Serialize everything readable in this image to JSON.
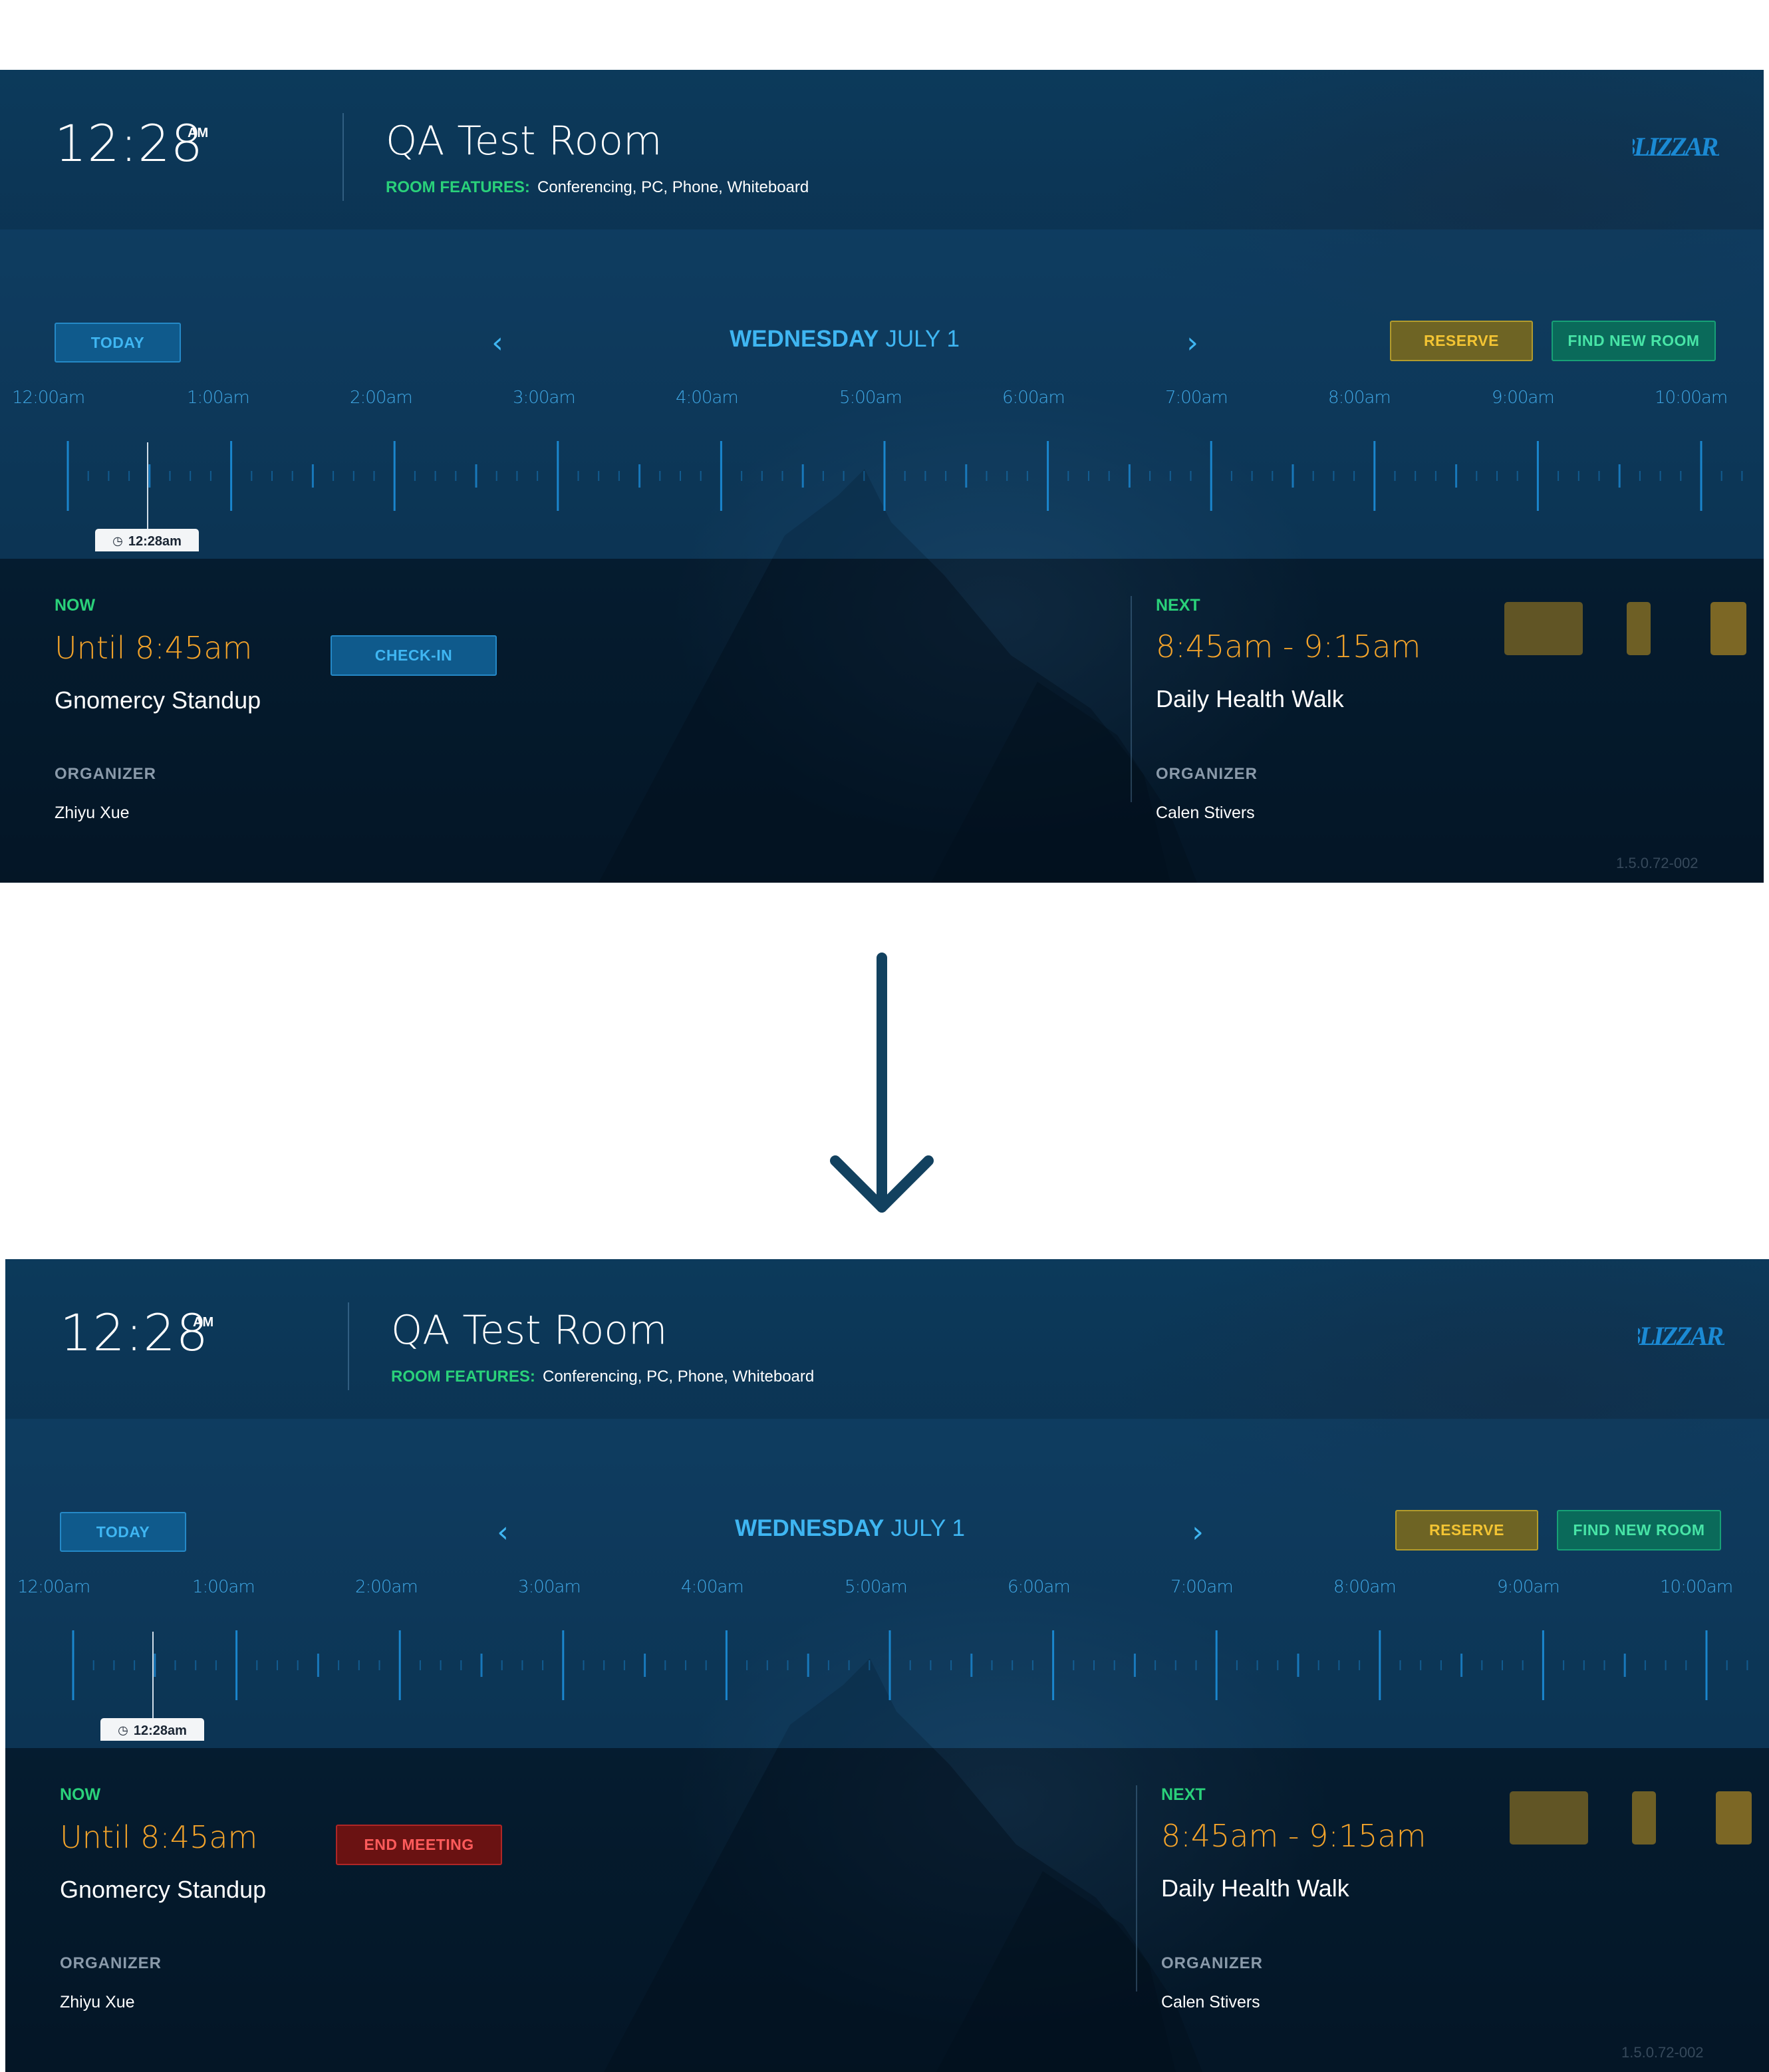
{
  "screens": [
    {
      "id": "before",
      "clock": {
        "time": "12:28",
        "ampm": "AM"
      },
      "room": {
        "name": "QA Test Room",
        "features_label": "ROOM FEATURES:",
        "features": "Conferencing, PC, Phone, Whiteboard"
      },
      "logo_text": "BLIZZARD",
      "toolbar": {
        "today": "TODAY",
        "date_day": "WEDNESDAY",
        "date_rest": "JULY 1",
        "reserve": "RESERVE",
        "find_room": "FIND NEW ROOM"
      },
      "timeline": {
        "hours": [
          "12:00am",
          "1:00am",
          "2:00am",
          "3:00am",
          "4:00am",
          "5:00am",
          "6:00am",
          "7:00am",
          "8:00am",
          "9:00am",
          "10:00am"
        ],
        "now_badge": "12:28am"
      },
      "now": {
        "label": "NOW",
        "time": "Until 8:45am",
        "title": "Gnomercy Standup",
        "organizer_label": "ORGANIZER",
        "organizer": "Zhiyu Xue",
        "action": "CHECK-IN"
      },
      "next": {
        "label": "NEXT",
        "time": "8:45am - 9:15am",
        "title": "Daily Health Walk",
        "organizer_label": "ORGANIZER",
        "organizer": "Calen Stivers"
      },
      "version": "1.5.0.72-002"
    },
    {
      "id": "after",
      "clock": {
        "time": "12:28",
        "ampm": "AM"
      },
      "room": {
        "name": "QA Test Room",
        "features_label": "ROOM FEATURES:",
        "features": "Conferencing, PC, Phone, Whiteboard"
      },
      "logo_text": "BLIZZARD",
      "toolbar": {
        "today": "TODAY",
        "date_day": "WEDNESDAY",
        "date_rest": "JULY 1",
        "reserve": "RESERVE",
        "find_room": "FIND NEW ROOM"
      },
      "timeline": {
        "hours": [
          "12:00am",
          "1:00am",
          "2:00am",
          "3:00am",
          "4:00am",
          "5:00am",
          "6:00am",
          "7:00am",
          "8:00am",
          "9:00am",
          "10:00am"
        ],
        "now_badge": "12:28am"
      },
      "now": {
        "label": "NOW",
        "time": "Until 8:45am",
        "title": "Gnomercy Standup",
        "organizer_label": "ORGANIZER",
        "organizer": "Zhiyu Xue",
        "action": "END MEETING"
      },
      "next": {
        "label": "NEXT",
        "time": "8:45am - 9:15am",
        "title": "Daily Health Walk",
        "organizer_label": "ORGANIZER",
        "organizer": "Calen Stivers"
      },
      "version": "1.5.0.72-002"
    }
  ],
  "colors": {
    "accent_blue": "#3fb6f2",
    "green": "#2ad17a",
    "orange": "#f3a32a",
    "reserve_gold": "#f3c433",
    "end_red": "#ff5b5b"
  },
  "icons": [
    "chevron-left-icon",
    "chevron-right-icon",
    "clock-icon",
    "down-arrow-icon"
  ]
}
